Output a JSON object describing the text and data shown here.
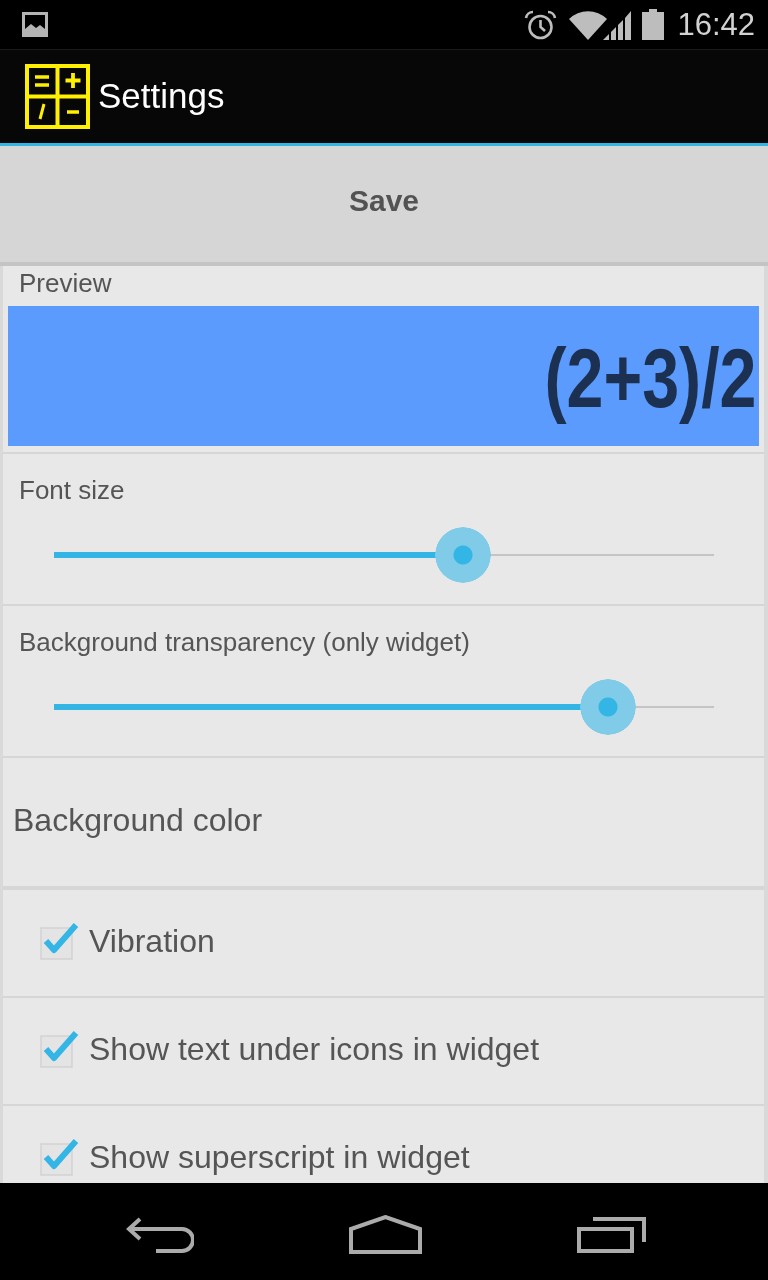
{
  "status_bar": {
    "time": "16:42"
  },
  "action_bar": {
    "title": "Settings"
  },
  "save_button": {
    "label": "Save"
  },
  "preview": {
    "label": "Preview",
    "expression": "(2+3)/2"
  },
  "settings": [
    {
      "kind": "slider",
      "label": "Font size",
      "level": 0.62
    },
    {
      "kind": "slider",
      "label": "Background transparency (only widget)",
      "level": 0.84
    },
    {
      "kind": "action",
      "label": "Background color"
    },
    {
      "kind": "checkbox",
      "label": "Vibration",
      "checked": true
    },
    {
      "kind": "checkbox",
      "label": "Show text under icons in widget",
      "checked": true
    },
    {
      "kind": "checkbox",
      "label": "Show superscript in widget",
      "checked": true
    }
  ]
}
